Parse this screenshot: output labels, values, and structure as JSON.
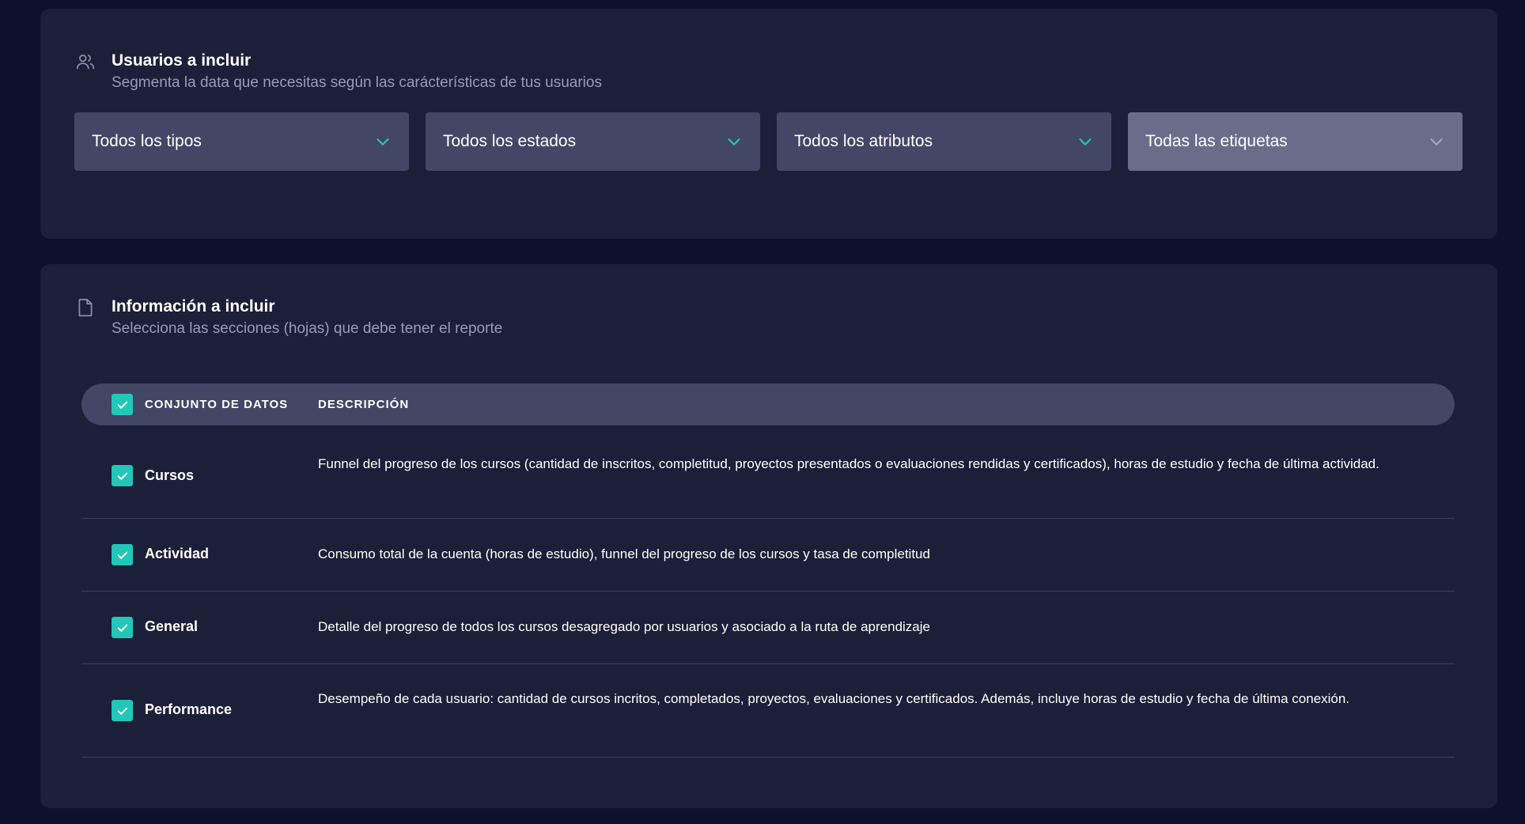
{
  "users_section": {
    "title": "Usuarios a incluir",
    "subtitle": "Segmenta la data que necesitas según las carácterísticas de tus usuarios",
    "icon": "users-icon",
    "filters": [
      {
        "label": "Todos los tipos",
        "disabled": false
      },
      {
        "label": "Todos los estados",
        "disabled": false
      },
      {
        "label": "Todos los atributos",
        "disabled": false
      },
      {
        "label": "Todas las etiquetas",
        "disabled": true
      }
    ]
  },
  "info_section": {
    "title": "Información a incluir",
    "subtitle": "Selecciona las secciones (hojas) que debe tener el reporte",
    "icon": "document-icon",
    "table": {
      "header": {
        "dataset": "CONJUNTO DE DATOS",
        "description": "DESCRIPCIÓN",
        "select_all_checked": true
      },
      "rows": [
        {
          "name": "Cursos",
          "checked": true,
          "description": "Funnel del progreso de los cursos (cantidad de inscritos, completitud, proyectos presentados o evaluaciones rendidas y certificados), horas de estudio y fecha de última actividad."
        },
        {
          "name": "Actividad",
          "checked": true,
          "description": "Consumo total de la cuenta (horas de estudio), funnel del progreso de los cursos y tasa de completitud"
        },
        {
          "name": "General",
          "checked": true,
          "description": "Detalle del progreso de todos los cursos desagregado por usuarios y asociado a la ruta de aprendizaje"
        },
        {
          "name": "Performance",
          "checked": true,
          "description": "Desempeño de cada usuario: cantidad de cursos incritos, completados, proyectos, evaluaciones y certificados. Además, incluye horas de estudio y fecha de última conexión."
        }
      ]
    }
  },
  "colors": {
    "background": "#0a1128",
    "card": "#1b1f37",
    "dropdown": "#434664",
    "dropdown_disabled": "#6a6d8a",
    "accent": "#22c7b8"
  }
}
